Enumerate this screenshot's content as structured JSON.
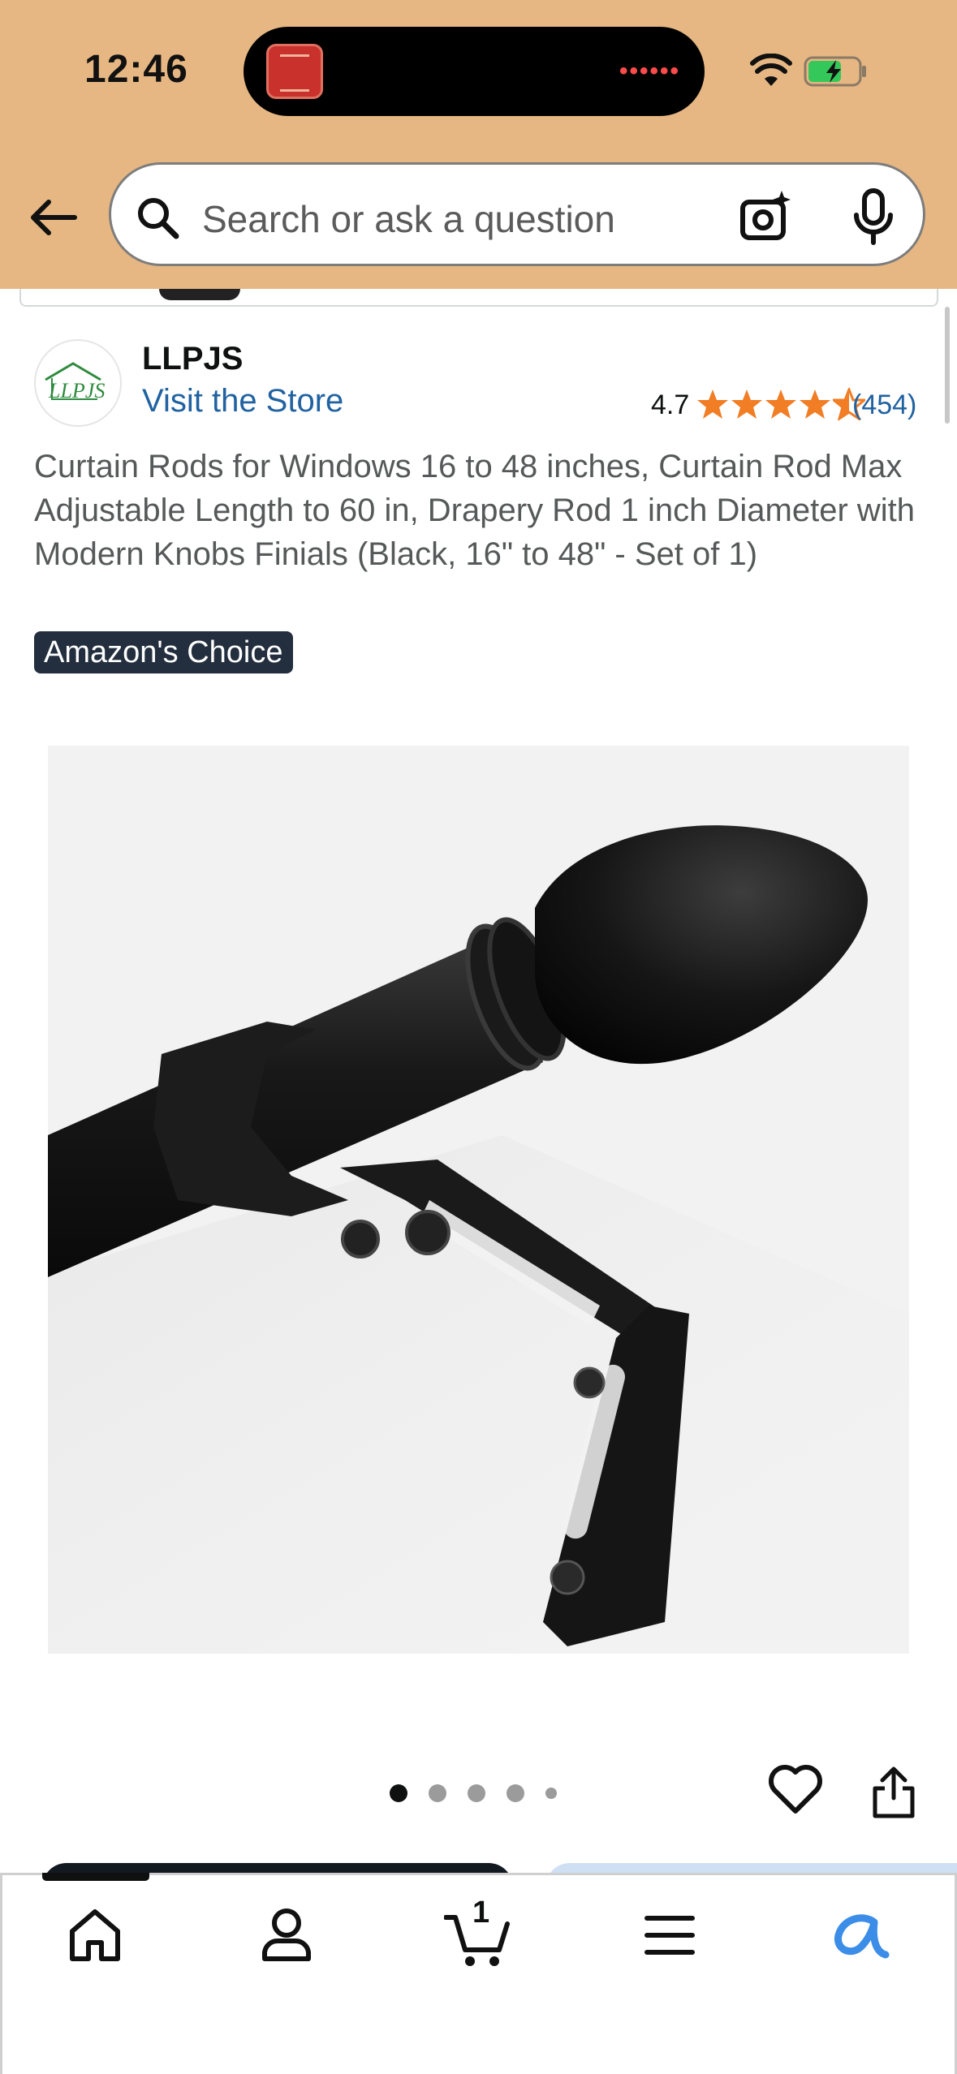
{
  "status_bar": {
    "time": "12:46"
  },
  "search": {
    "placeholder": "Search or ask a question"
  },
  "brand": {
    "name": "LLPJS",
    "logo_text": "LLPJS",
    "visit_store": "Visit the Store",
    "rating": "4.7",
    "stars_filled": 4.5,
    "review_count": "(454)"
  },
  "product": {
    "title": "Curtain Rods for Windows 16 to 48 inches, Curtain Rod Max Adjustable Length to 60 in, Drapery Rod 1 inch Diameter with Modern Knobs Finials (Black, 16\" to 48\" - Set of 1)",
    "badge": "Amazon's Choice",
    "image_alt": "Black curtain rod with round finial and wall bracket"
  },
  "carousel": {
    "total_dots": 5,
    "active_index": 0
  },
  "bottom_nav": {
    "items": [
      "home",
      "account",
      "cart",
      "menu",
      "rufus"
    ],
    "cart_count": "1"
  },
  "colors": {
    "header_bg": "#e6b783",
    "link": "#2162a1",
    "star": "#f17d25",
    "badge_bg": "#232f3e",
    "rufus_accent": "#3b8de8"
  }
}
